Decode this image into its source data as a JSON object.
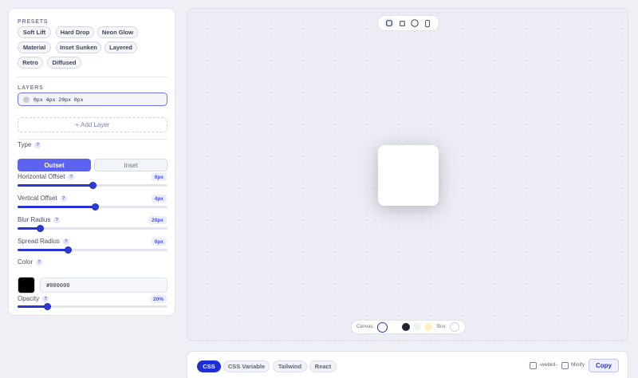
{
  "presets": {
    "title": "PRESETS",
    "items": [
      "Soft Lift",
      "Hard Drop",
      "Neon Glow",
      "Material",
      "Inset Sunken",
      "Layered",
      "Retro",
      "Diffused"
    ]
  },
  "layers": {
    "title": "LAYERS",
    "items": [
      {
        "value": "0px 4px 20px 0px",
        "color": "#c9cbd3"
      }
    ],
    "add_label": "+ Add Layer"
  },
  "type": {
    "label": "Type",
    "options": [
      "Outset",
      "Inset"
    ],
    "selected": "Outset"
  },
  "sliders": [
    {
      "label": "Horizontal Offset",
      "value": "0px",
      "level": 0.5
    },
    {
      "label": "Vertical Offset",
      "value": "4px",
      "level": 0.52
    },
    {
      "label": "Blur Radius",
      "value": "20px",
      "level": 0.15
    },
    {
      "label": "Spread Radius",
      "value": "0px",
      "level": 0.34
    }
  ],
  "color": {
    "label": "Color",
    "hex": "#000000"
  },
  "opacity": {
    "label": "Opacity",
    "value": "20%",
    "level": 0.2
  },
  "help_glyph": "?",
  "canvas": {
    "shape_icons": [
      "square-rounded-icon",
      "square-icon",
      "circle-icon",
      "phone-icon"
    ],
    "canvas_label": "Canvas:",
    "box_label": "Box:",
    "canvas_colors": [
      "#ffffff",
      "#1f2436",
      "#e9f5ee",
      "#fdf0c2"
    ],
    "box_colors": [
      "#ffffff"
    ]
  },
  "output": {
    "tabs": [
      "CSS",
      "CSS Variable",
      "Tailwind",
      "React"
    ],
    "active_tab": "CSS",
    "webkit_label": "-webkit-",
    "minify_label": "Minify",
    "copy_label": "Copy"
  },
  "colors": {
    "accent": "#5b63f0",
    "active_tab": "#1f2fd6"
  }
}
